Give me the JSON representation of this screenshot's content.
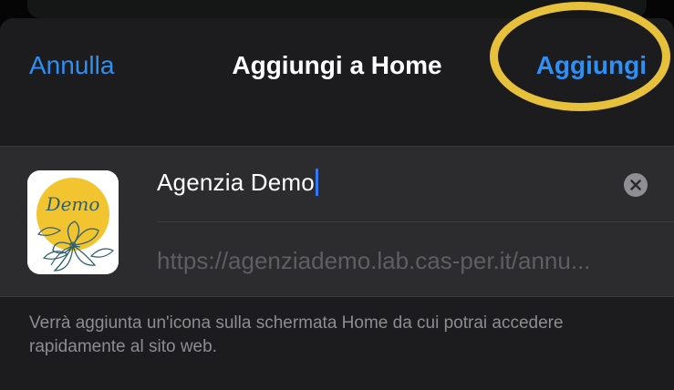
{
  "nav": {
    "cancel_label": "Annulla",
    "title": "Aggiungi a Home",
    "add_label": "Aggiungi"
  },
  "form": {
    "name_value": "Agenzia Demo",
    "url_value": "https://agenziademo.lab.cas-per.it/annu...",
    "icon_text": "Demo"
  },
  "footnote": "Verrà aggiunta un'icona sulla schermata Home da cui potrai accedere rapidamente al sito web.",
  "colors": {
    "accent": "#2e8ff5",
    "highlight": "#e8c13c",
    "icon_yellow": "#f2c530"
  },
  "icons": {
    "clear": "clear-text-icon"
  }
}
